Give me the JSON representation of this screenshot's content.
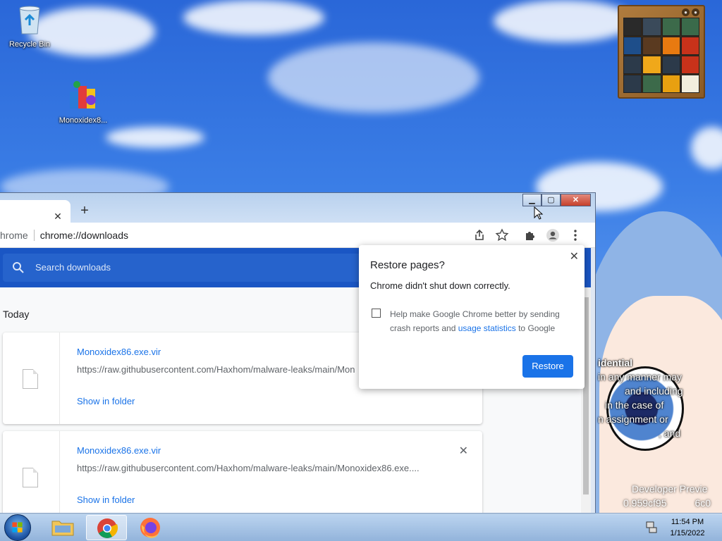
{
  "desktop": {
    "icons": [
      {
        "label": "Recycle Bin"
      },
      {
        "label": "Monoxidex8..."
      }
    ],
    "wallpaper_text": {
      "line1": "idential",
      "line2": "in any manner may",
      "line3": "and including",
      "line4": "in the case of",
      "line5": "n assignment or",
      "line6": ", and",
      "line7": "Developer Previe",
      "line8": "0.959cf95",
      "line9": "6c0"
    }
  },
  "window": {
    "tab_close": "✕",
    "new_tab": "+",
    "controls": {
      "minimize": "▁",
      "maximize": "▢",
      "close": "✕"
    }
  },
  "toolbar": {
    "scheme": "hrome",
    "url": "chrome://downloads"
  },
  "downloads": {
    "search_placeholder": "Search downloads",
    "section_label": "Today",
    "items": [
      {
        "filename": "Monoxidex86.exe.vir",
        "url": "https://raw.githubusercontent.com/Haxhom/malware-leaks/main/Mon",
        "action": "Show in folder"
      },
      {
        "filename": "Monoxidex86.exe.vir",
        "url": "https://raw.githubusercontent.com/Haxhom/malware-leaks/main/Monoxidex86.exe....",
        "action": "Show in folder",
        "remove": "✕"
      }
    ]
  },
  "dialog": {
    "title": "Restore pages?",
    "message": "Chrome didn't shut down correctly.",
    "checkbox_text_1": "Help make Google Chrome better by sending crash reports and ",
    "checkbox_link": "usage statistics",
    "checkbox_text_2": " to Google",
    "button": "Restore",
    "close": "✕"
  },
  "taskbar": {
    "time": "11:54 PM",
    "date": "1/15/2022"
  },
  "colors": {
    "accent": "#1a73e8",
    "search_bar": "#1a56c4"
  }
}
